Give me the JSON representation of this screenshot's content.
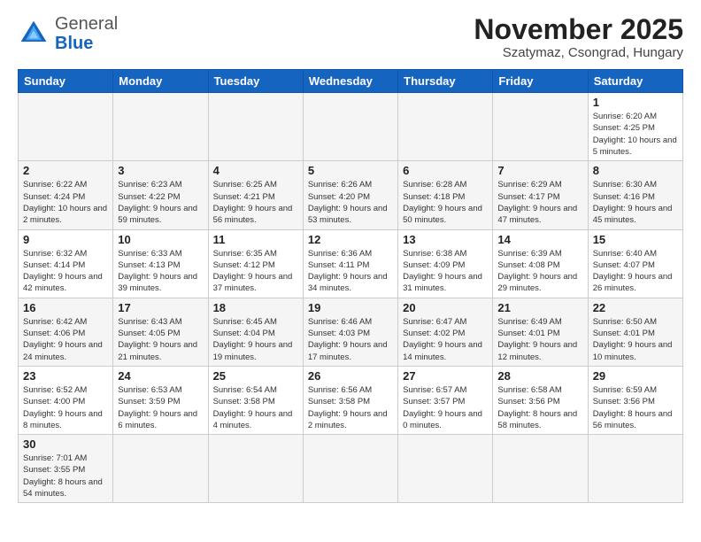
{
  "header": {
    "logo": {
      "general": "General",
      "blue": "Blue"
    },
    "title": "November 2025",
    "subtitle": "Szatymaz, Csongrad, Hungary"
  },
  "weekdays": [
    "Sunday",
    "Monday",
    "Tuesday",
    "Wednesday",
    "Thursday",
    "Friday",
    "Saturday"
  ],
  "weeks": [
    [
      {
        "day": null,
        "info": null
      },
      {
        "day": null,
        "info": null
      },
      {
        "day": null,
        "info": null
      },
      {
        "day": null,
        "info": null
      },
      {
        "day": null,
        "info": null
      },
      {
        "day": null,
        "info": null
      },
      {
        "day": "1",
        "info": "Sunrise: 6:20 AM\nSunset: 4:25 PM\nDaylight: 10 hours\nand 5 minutes."
      }
    ],
    [
      {
        "day": "2",
        "info": "Sunrise: 6:22 AM\nSunset: 4:24 PM\nDaylight: 10 hours\nand 2 minutes."
      },
      {
        "day": "3",
        "info": "Sunrise: 6:23 AM\nSunset: 4:22 PM\nDaylight: 9 hours\nand 59 minutes."
      },
      {
        "day": "4",
        "info": "Sunrise: 6:25 AM\nSunset: 4:21 PM\nDaylight: 9 hours\nand 56 minutes."
      },
      {
        "day": "5",
        "info": "Sunrise: 6:26 AM\nSunset: 4:20 PM\nDaylight: 9 hours\nand 53 minutes."
      },
      {
        "day": "6",
        "info": "Sunrise: 6:28 AM\nSunset: 4:18 PM\nDaylight: 9 hours\nand 50 minutes."
      },
      {
        "day": "7",
        "info": "Sunrise: 6:29 AM\nSunset: 4:17 PM\nDaylight: 9 hours\nand 47 minutes."
      },
      {
        "day": "8",
        "info": "Sunrise: 6:30 AM\nSunset: 4:16 PM\nDaylight: 9 hours\nand 45 minutes."
      }
    ],
    [
      {
        "day": "9",
        "info": "Sunrise: 6:32 AM\nSunset: 4:14 PM\nDaylight: 9 hours\nand 42 minutes."
      },
      {
        "day": "10",
        "info": "Sunrise: 6:33 AM\nSunset: 4:13 PM\nDaylight: 9 hours\nand 39 minutes."
      },
      {
        "day": "11",
        "info": "Sunrise: 6:35 AM\nSunset: 4:12 PM\nDaylight: 9 hours\nand 37 minutes."
      },
      {
        "day": "12",
        "info": "Sunrise: 6:36 AM\nSunset: 4:11 PM\nDaylight: 9 hours\nand 34 minutes."
      },
      {
        "day": "13",
        "info": "Sunrise: 6:38 AM\nSunset: 4:09 PM\nDaylight: 9 hours\nand 31 minutes."
      },
      {
        "day": "14",
        "info": "Sunrise: 6:39 AM\nSunset: 4:08 PM\nDaylight: 9 hours\nand 29 minutes."
      },
      {
        "day": "15",
        "info": "Sunrise: 6:40 AM\nSunset: 4:07 PM\nDaylight: 9 hours\nand 26 minutes."
      }
    ],
    [
      {
        "day": "16",
        "info": "Sunrise: 6:42 AM\nSunset: 4:06 PM\nDaylight: 9 hours\nand 24 minutes."
      },
      {
        "day": "17",
        "info": "Sunrise: 6:43 AM\nSunset: 4:05 PM\nDaylight: 9 hours\nand 21 minutes."
      },
      {
        "day": "18",
        "info": "Sunrise: 6:45 AM\nSunset: 4:04 PM\nDaylight: 9 hours\nand 19 minutes."
      },
      {
        "day": "19",
        "info": "Sunrise: 6:46 AM\nSunset: 4:03 PM\nDaylight: 9 hours\nand 17 minutes."
      },
      {
        "day": "20",
        "info": "Sunrise: 6:47 AM\nSunset: 4:02 PM\nDaylight: 9 hours\nand 14 minutes."
      },
      {
        "day": "21",
        "info": "Sunrise: 6:49 AM\nSunset: 4:01 PM\nDaylight: 9 hours\nand 12 minutes."
      },
      {
        "day": "22",
        "info": "Sunrise: 6:50 AM\nSunset: 4:01 PM\nDaylight: 9 hours\nand 10 minutes."
      }
    ],
    [
      {
        "day": "23",
        "info": "Sunrise: 6:52 AM\nSunset: 4:00 PM\nDaylight: 9 hours\nand 8 minutes."
      },
      {
        "day": "24",
        "info": "Sunrise: 6:53 AM\nSunset: 3:59 PM\nDaylight: 9 hours\nand 6 minutes."
      },
      {
        "day": "25",
        "info": "Sunrise: 6:54 AM\nSunset: 3:58 PM\nDaylight: 9 hours\nand 4 minutes."
      },
      {
        "day": "26",
        "info": "Sunrise: 6:56 AM\nSunset: 3:58 PM\nDaylight: 9 hours\nand 2 minutes."
      },
      {
        "day": "27",
        "info": "Sunrise: 6:57 AM\nSunset: 3:57 PM\nDaylight: 9 hours\nand 0 minutes."
      },
      {
        "day": "28",
        "info": "Sunrise: 6:58 AM\nSunset: 3:56 PM\nDaylight: 8 hours\nand 58 minutes."
      },
      {
        "day": "29",
        "info": "Sunrise: 6:59 AM\nSunset: 3:56 PM\nDaylight: 8 hours\nand 56 minutes."
      }
    ],
    [
      {
        "day": "30",
        "info": "Sunrise: 7:01 AM\nSunset: 3:55 PM\nDaylight: 8 hours\nand 54 minutes."
      },
      {
        "day": null,
        "info": null
      },
      {
        "day": null,
        "info": null
      },
      {
        "day": null,
        "info": null
      },
      {
        "day": null,
        "info": null
      },
      {
        "day": null,
        "info": null
      },
      {
        "day": null,
        "info": null
      }
    ]
  ]
}
